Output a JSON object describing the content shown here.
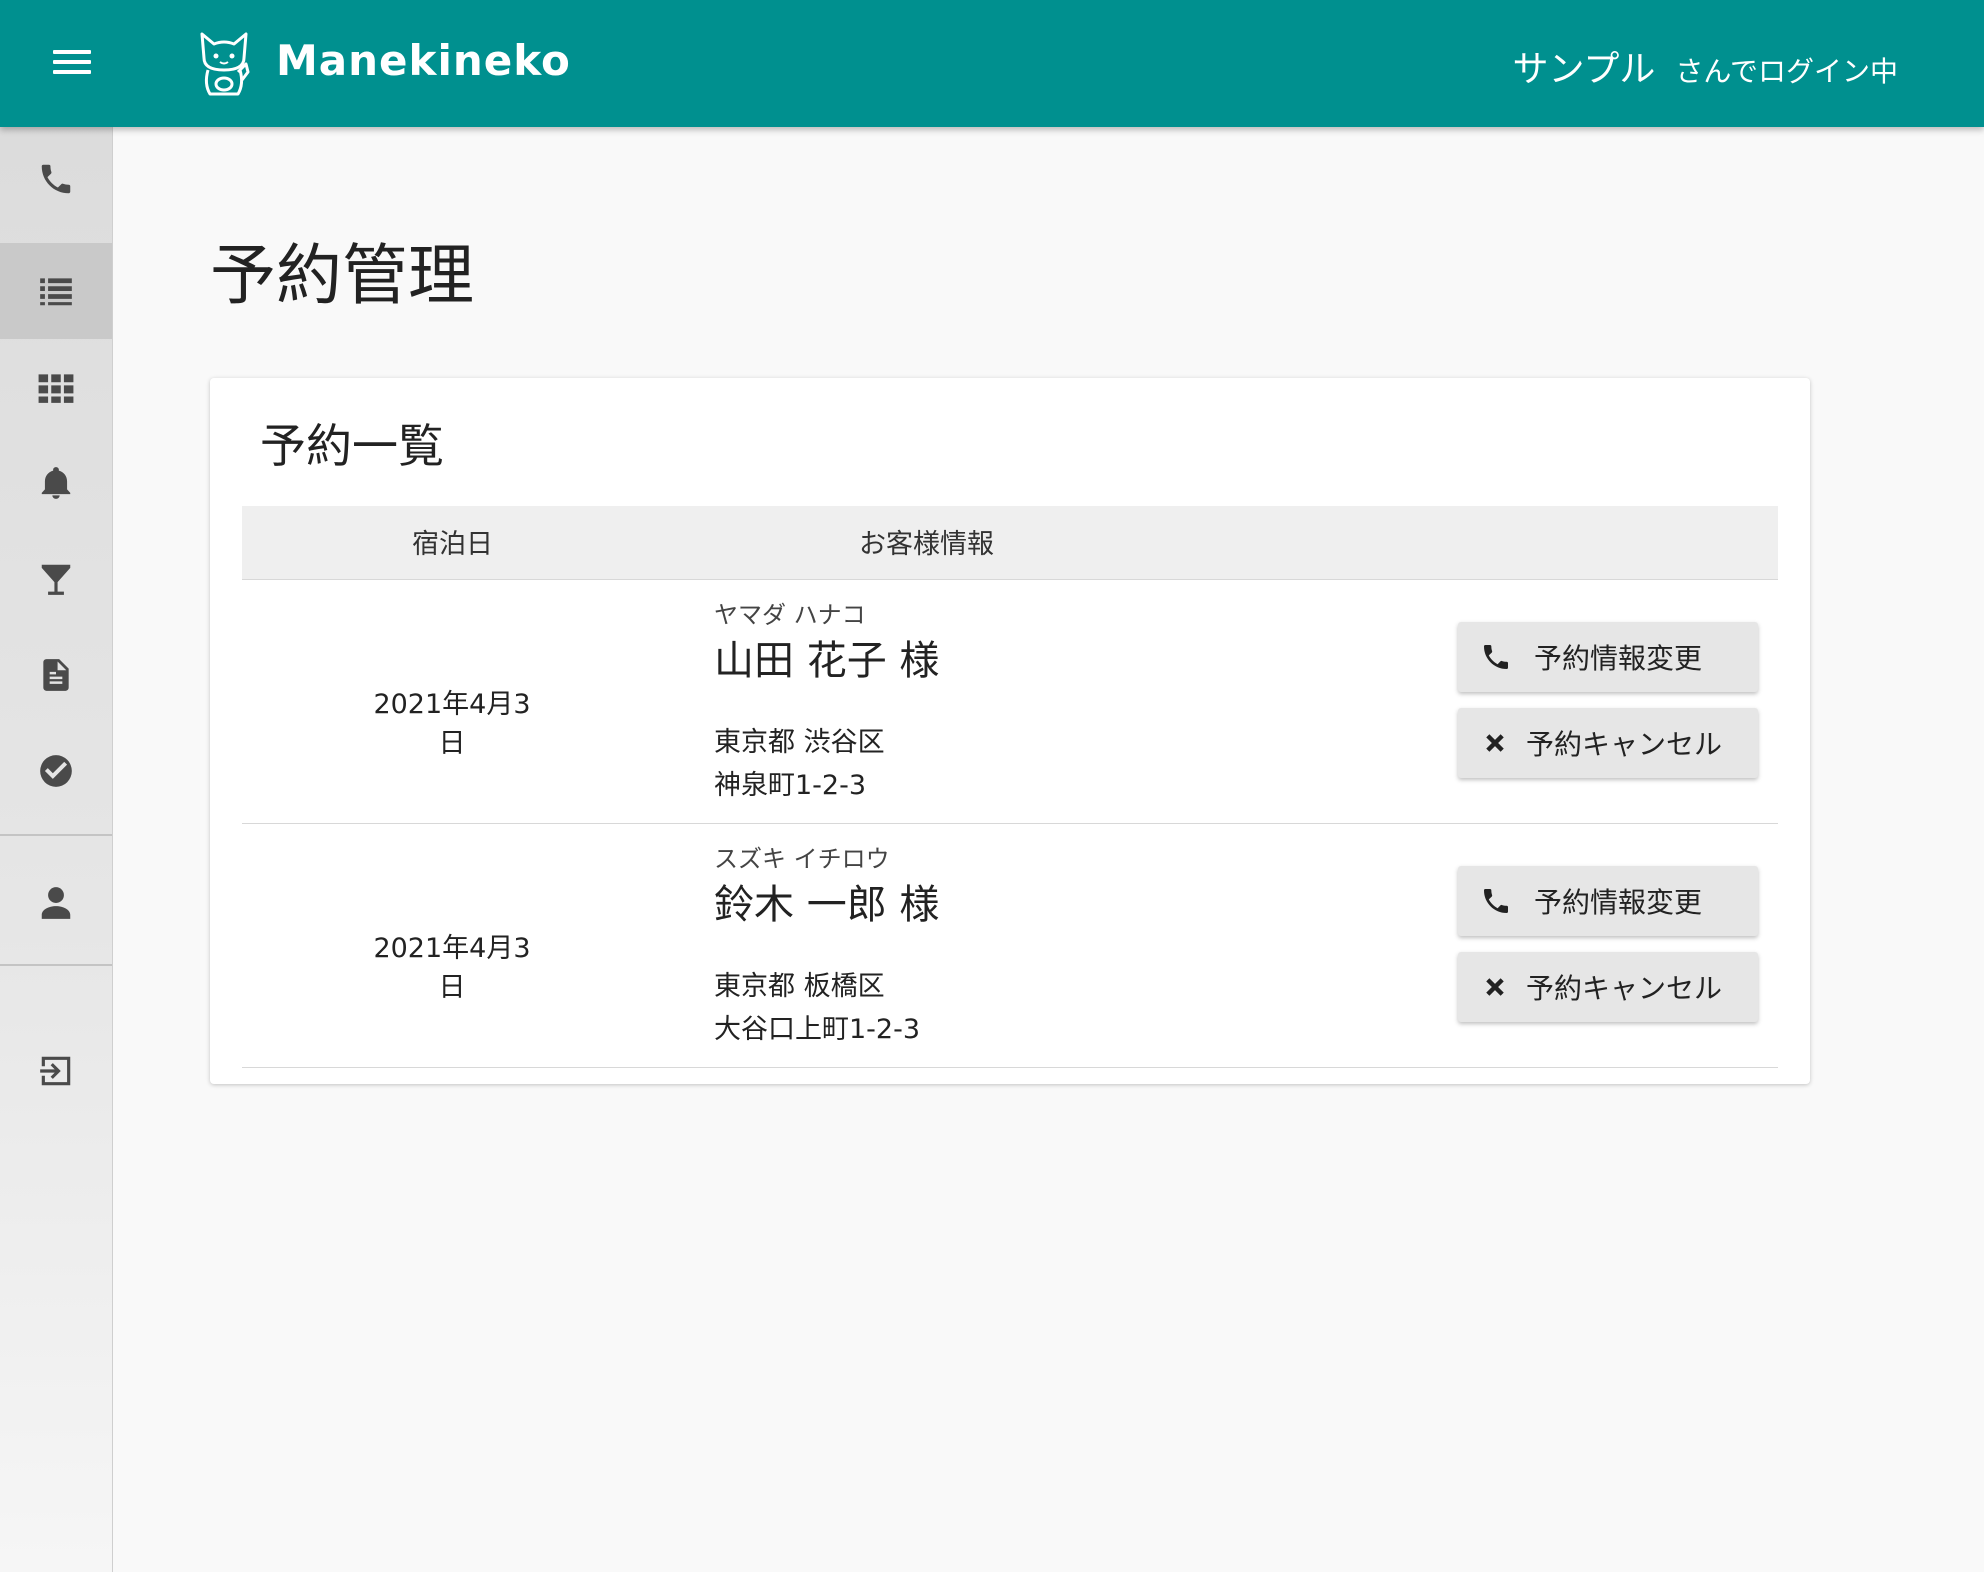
{
  "header": {
    "brand": "Manekineko",
    "user_name": "サンプル",
    "login_suffix": "さんでログイン中"
  },
  "sidebar": {
    "items": [
      {
        "icon": "phone-icon"
      },
      {
        "icon": "list-icon",
        "active": true
      },
      {
        "icon": "grid-icon"
      },
      {
        "icon": "bell-icon"
      },
      {
        "icon": "cocktail-icon"
      },
      {
        "icon": "document-icon"
      },
      {
        "icon": "check-circle-icon"
      },
      {
        "icon": "user-icon"
      },
      {
        "icon": "logout-icon"
      }
    ]
  },
  "main": {
    "page_title": "予約管理",
    "card_title": "予約一覧",
    "columns": [
      "宿泊日",
      "お客様情報"
    ],
    "reservations": [
      {
        "date": "2021年4月3日",
        "kana": "ヤマダ ハナコ",
        "name": "山田 花子 様",
        "address_line1": "東京都 渋谷区",
        "address_line2": "神泉町1-2-3",
        "change_label": "予約情報変更",
        "cancel_label": "予約キャンセル"
      },
      {
        "date": "2021年4月3日",
        "kana": "スズキ イチロウ",
        "name": "鈴木 一郎 様",
        "address_line1": "東京都 板橋区",
        "address_line2": "大谷口上町1-2-3",
        "change_label": "予約情報変更",
        "cancel_label": "予約キャンセル"
      }
    ]
  },
  "colors": {
    "header": "#00908f",
    "sidebar_active": "#c9c9c9",
    "button": "#e6e6e6"
  }
}
